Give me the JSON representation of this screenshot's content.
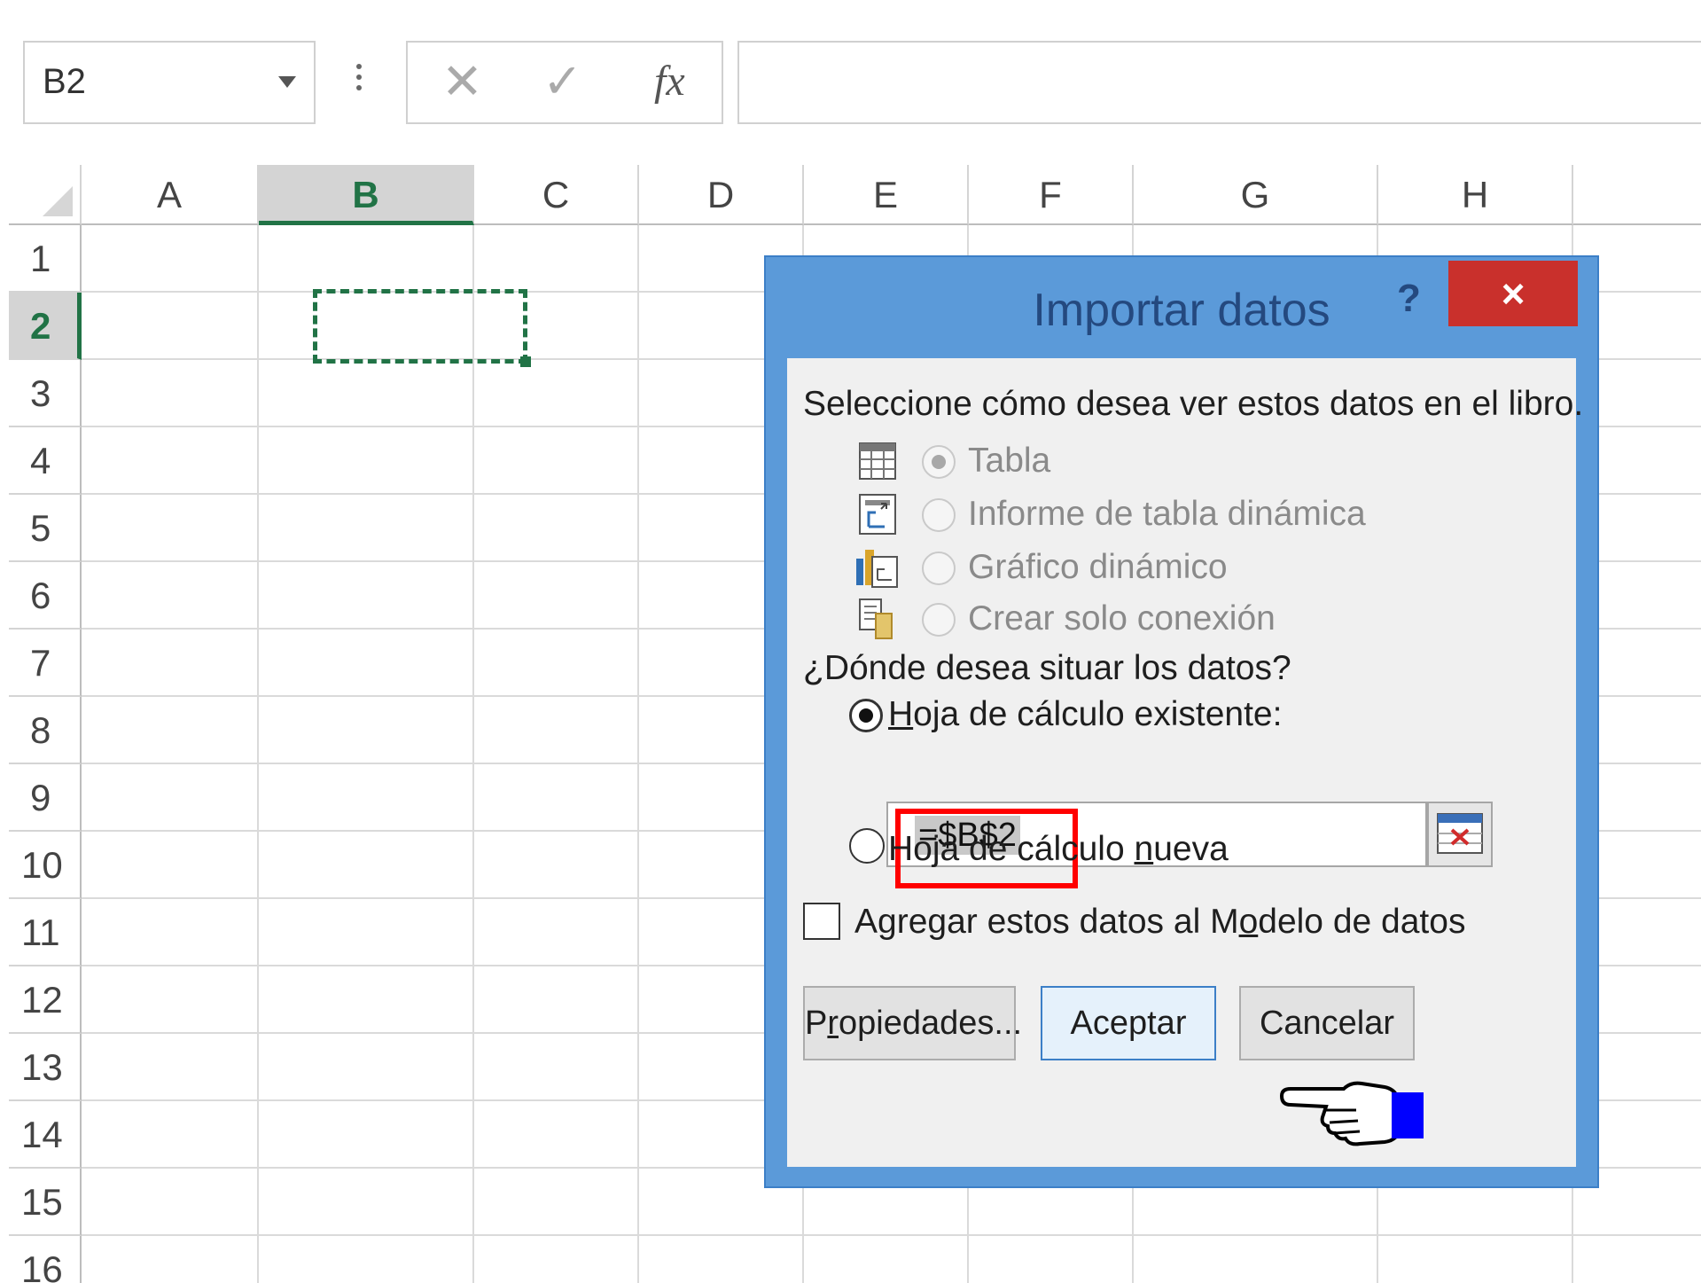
{
  "formula_bar": {
    "name_box": "B2",
    "formula": ""
  },
  "grid": {
    "columns": [
      "A",
      "B",
      "C",
      "D",
      "E",
      "F",
      "G",
      "H"
    ],
    "rows": [
      "1",
      "2",
      "3",
      "4",
      "5",
      "6",
      "7",
      "8",
      "9",
      "10",
      "11",
      "12",
      "13",
      "14",
      "15",
      "16"
    ],
    "selected_column": "B",
    "selected_row": "2",
    "active_cell": "B2"
  },
  "dialog": {
    "title": "Importar datos",
    "help": "?",
    "close": "×",
    "view_prompt": "Seleccione cómo desea ver estos datos en el libro.",
    "view_options": [
      {
        "label": "Tabla",
        "icon": "table-icon",
        "selected": true,
        "enabled": false
      },
      {
        "label": "Informe de tabla dinámica",
        "icon": "pivot-table-icon",
        "selected": false,
        "enabled": false
      },
      {
        "label": "Gráfico dinámico",
        "icon": "pivot-chart-icon",
        "selected": false,
        "enabled": false
      },
      {
        "label": "Crear solo conexión",
        "icon": "connection-only-icon",
        "selected": false,
        "enabled": false
      }
    ],
    "location_prompt": "¿Dónde desea situar los datos?",
    "existing_sheet": {
      "pre": "",
      "key": "H",
      "post": "oja de cálculo existente:",
      "selected": true
    },
    "location_value": "=$B$2",
    "new_sheet": {
      "pre": "Hoja de cálculo ",
      "key": "n",
      "post": "ueva",
      "selected": false
    },
    "add_to_model": {
      "pre": "Agregar estos datos al M",
      "key": "o",
      "post": "delo de datos",
      "checked": false
    },
    "buttons": {
      "properties": {
        "pre": "P",
        "key": "r",
        "post": "opiedades..."
      },
      "accept": "Aceptar",
      "cancel": "Cancelar"
    }
  },
  "colors": {
    "accent_green": "#217346",
    "dialog_border": "#5b9ad9",
    "close_red": "#c9302c",
    "highlight_red": "#ff0000",
    "cursor_blue": "#0000ff"
  }
}
